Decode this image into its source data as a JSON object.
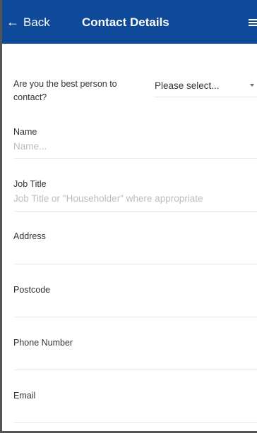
{
  "header": {
    "back_arrow": "←",
    "back_label": "Back",
    "title": "Contact Details",
    "background_color": "#0e4a99",
    "menu_icon": "hamburger-menu-icon"
  },
  "form": {
    "best_person": {
      "label": "Are you the best person to contact?",
      "selected_value": "Please select..."
    },
    "name": {
      "label": "Name",
      "placeholder": "Name..."
    },
    "job_title": {
      "label": "Job Title",
      "placeholder": "Job Title or \"Householder\" where appropriate"
    },
    "address": {
      "label": "Address"
    },
    "postcode": {
      "label": "Postcode"
    },
    "phone_number": {
      "label": "Phone Number"
    },
    "email": {
      "label": "Email"
    }
  }
}
